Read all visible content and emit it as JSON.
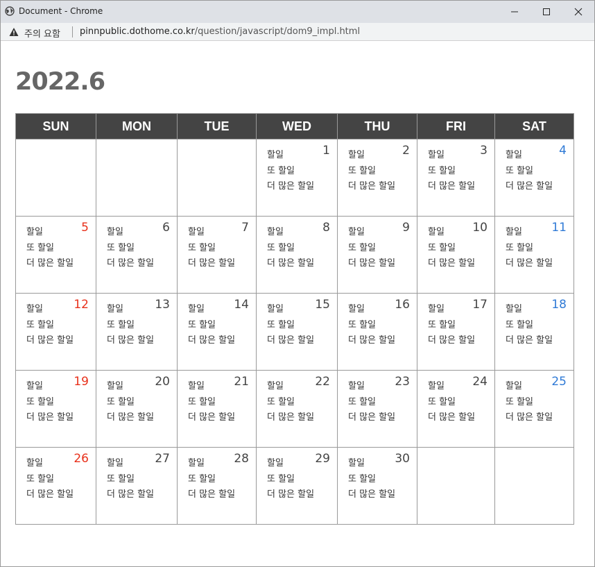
{
  "window": {
    "title": "Document - Chrome",
    "controls": {
      "minimize": "—",
      "maximize": "☐",
      "close": "✕"
    }
  },
  "address_bar": {
    "warning_text": "주의 요함",
    "url_host": "pinnpublic.dothome.co.kr",
    "url_path": "/question/javascript/dom9_impl.html"
  },
  "calendar": {
    "title": "2022.6",
    "weekdays": [
      "SUN",
      "MON",
      "TUE",
      "WED",
      "THU",
      "FRI",
      "SAT"
    ],
    "todo_items": [
      "할일",
      "또 할일",
      "더 많은 할일"
    ],
    "weeks": [
      [
        "",
        "",
        "",
        "1",
        "2",
        "3",
        "4"
      ],
      [
        "5",
        "6",
        "7",
        "8",
        "9",
        "10",
        "11"
      ],
      [
        "12",
        "13",
        "14",
        "15",
        "16",
        "17",
        "18"
      ],
      [
        "19",
        "20",
        "21",
        "22",
        "23",
        "24",
        "25"
      ],
      [
        "26",
        "27",
        "28",
        "29",
        "30",
        "",
        ""
      ]
    ]
  },
  "colors": {
    "header_bg": "#444444",
    "sunday": "#e8301a",
    "saturday": "#2f7ad6",
    "title": "#666666"
  }
}
